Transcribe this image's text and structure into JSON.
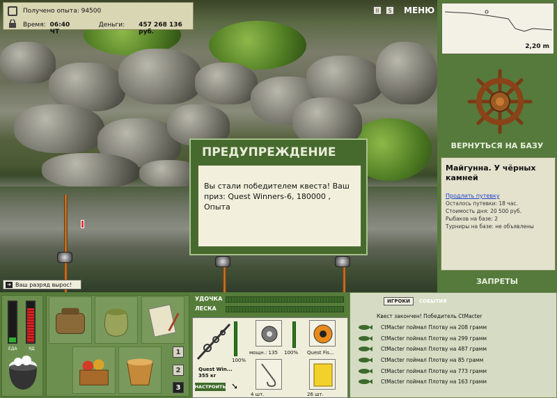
{
  "hud": {
    "experience_text": "Получено опыта: 94500",
    "time_label": "Время:",
    "time_value": "06:40 ЧТ",
    "money_label": "Деньги:",
    "money_value": "457 268 136 руб.",
    "menu_label": "МЕНЮ",
    "pause_glyph": "II",
    "sound_glyph": "S"
  },
  "dialog": {
    "title": "ПРЕДУПРЕЖДЕНИЕ",
    "message": "Вы стали победителем квеста! Ваш приз: Quest Winners-6, 180000 , Опыта"
  },
  "toast": {
    "text": "Ваш разряд вырос!"
  },
  "depth": {
    "value": "2,20 m"
  },
  "nav": {
    "return_base": "ВЕРНУТЬСЯ НА БАЗУ",
    "bans": "ЗАПРЕТЫ"
  },
  "location": {
    "title": "Майгунна. У чёрных камней",
    "extend_link": "Продлить путевку",
    "remaining": "Осталось путевки: 18 час.",
    "day_cost": "Стоимость дня: 20 500 руб.",
    "fishers": "Рыбаков на базе: 2",
    "tournaments": "Турниры на базе: не объявлены"
  },
  "status_bars": {
    "food_label": "ЕДА",
    "poison_label": "ЯД",
    "food_level": 0.12,
    "poison_level": 0.85,
    "food_color": "#2fae2f",
    "poison_color": "#d22323"
  },
  "quick_slots": [
    "1",
    "2",
    "3"
  ],
  "tackle": {
    "rod_label": "УДОЧКА",
    "line_label": "ЛЕСКА",
    "rod_name": "Quest Win...",
    "rod_weight": "355 кг",
    "rod_percent": "100%",
    "setup_button": "НАСТРОИТЬ",
    "reel_caption": "мощн.: 135",
    "reel_percent": "100%",
    "line_caption": "Quest Fis...",
    "hook_caption": "4 шт.",
    "bait_caption": "26 шт."
  },
  "events": {
    "tab_players": "ИГРОКИ",
    "tab_events": "СОБЫТИЯ",
    "items": [
      "Квест закончен! Победитель CtMacter",
      "CtMacter поймал Плотву на 208 грамм",
      "CtMacter поймал Плотву на 299 грамм",
      "CtMacter поймал Плотву на 487 грамм",
      "CtMacter поймал Плотву на 85 грамм",
      "CtMacter поймал Плотву на 773 грамм",
      "CtMacter поймал Плотву на 163 грамм"
    ]
  }
}
